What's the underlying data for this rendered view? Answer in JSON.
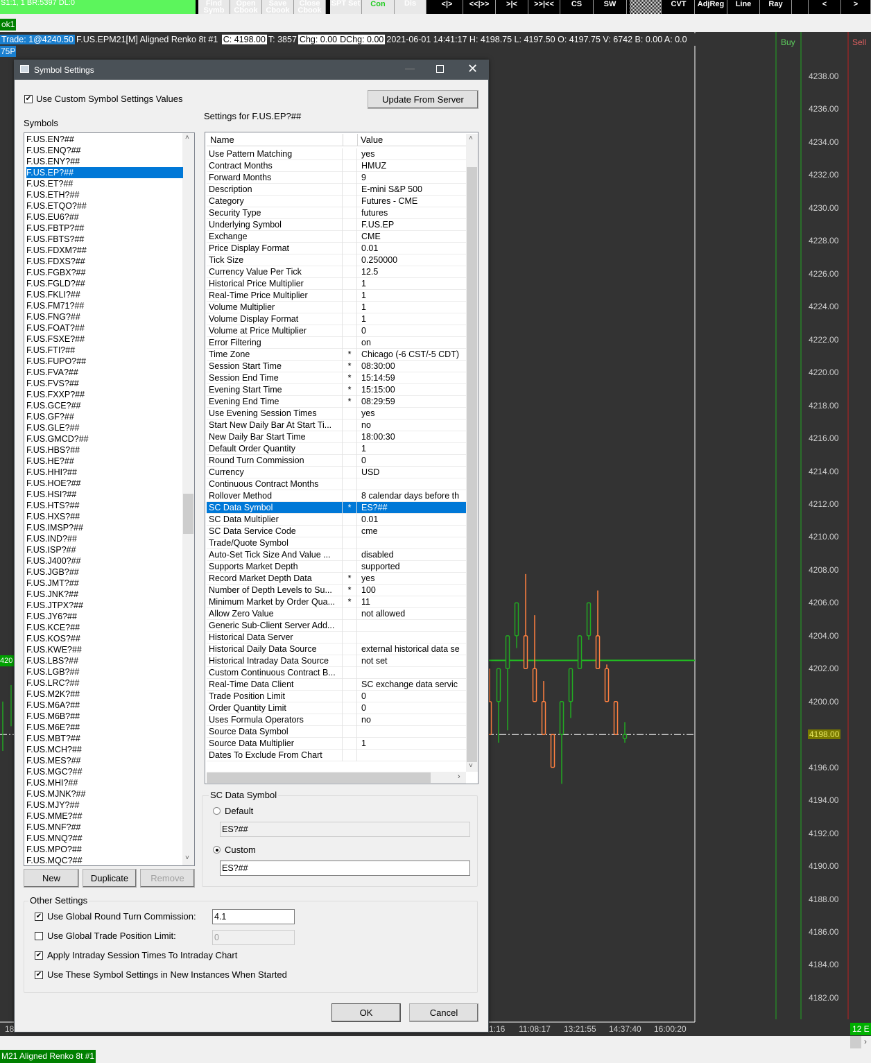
{
  "topbar": {
    "status": "S1:1, 1  BR:5397  DL:0",
    "left_buttons": [
      "Find Symb",
      "Open Cbook",
      "Save Cbook",
      "Close Cbook",
      "SPT Set",
      "Con",
      "Dis"
    ],
    "tool_buttons": [
      "<|>",
      "<<|>>",
      ">|<",
      ">>|<<",
      "CS",
      "SW",
      "",
      "CVT",
      "AdjReg",
      "Line",
      "Ray",
      "",
      "<",
      ">"
    ],
    "con_color": "#22cc22"
  },
  "tabs": {
    "top_tab": "ok1",
    "bottom_tab": "M21  Aligned Renko 8t  #1"
  },
  "chart_info": {
    "trade": "Trade: 1@4240.50",
    "symbol": "F.US.EPM21[M]  Aligned Renko 8t  #1",
    "close": "C: 4198.00",
    "ticks": "T: 3857",
    "chg": "Chg: 0.00",
    "dchg": "DChg: 0.00",
    "rest": "2021-06-01 14:41:17 H: 4198.75 L: 4197.50 O: 4197.75 V: 6742 B: 0.00 A: 0.0",
    "second_line": "75P",
    "buy_label": "Buy",
    "sell_label": "Sell",
    "left_price_tag": "420",
    "left_time_fragment": "18",
    "right_tag": "12 E"
  },
  "chart_data": {
    "type": "candlestick",
    "y_ticks": [
      "4238.00",
      "4236.00",
      "4234.00",
      "4232.00",
      "4230.00",
      "4228.00",
      "4226.00",
      "4224.00",
      "4222.00",
      "4220.00",
      "4218.00",
      "4216.00",
      "4214.00",
      "4212.00",
      "4210.00",
      "4208.00",
      "4206.00",
      "4204.00",
      "4202.00",
      "4200.00",
      "4198.00",
      "4196.00",
      "4194.00",
      "4192.00",
      "4190.00",
      "4188.00",
      "4186.00",
      "4184.00",
      "4182.00"
    ],
    "ylim": [
      4182,
      4238
    ],
    "current_price_label": "4198.00",
    "current_price": 4198,
    "green_level": 4202.5,
    "x_ticks": [
      "1:16",
      "11:08:17",
      "13:21:55",
      "14:37:40",
      "16:00:20"
    ],
    "up_color": "#22a822",
    "down_color": "#ff8040",
    "candles": [
      {
        "o": 4200,
        "h": 4202,
        "l": 4198,
        "c": 4198
      },
      {
        "o": 4200,
        "h": 4202,
        "l": 4197.5,
        "c": 4202
      },
      {
        "o": 4202,
        "h": 4204,
        "l": 4198.25,
        "c": 4204
      },
      {
        "o": 4204,
        "h": 4206,
        "l": 4203.25,
        "c": 4206
      },
      {
        "o": 4204,
        "h": 4207.75,
        "l": 4202,
        "c": 4202
      },
      {
        "o": 4202,
        "h": 4205.25,
        "l": 4200,
        "c": 4200
      },
      {
        "o": 4200,
        "h": 4201.25,
        "l": 4198,
        "c": 4198
      },
      {
        "o": 4198,
        "h": 4198,
        "l": 4196,
        "c": 4196
      },
      {
        "o": 4198,
        "h": 4200,
        "l": 4195,
        "c": 4200
      },
      {
        "o": 4200,
        "h": 4202,
        "l": 4199,
        "c": 4202
      },
      {
        "o": 4202,
        "h": 4204,
        "l": 4202,
        "c": 4204
      },
      {
        "o": 4204,
        "h": 4206,
        "l": 4203.75,
        "c": 4206
      },
      {
        "o": 4204,
        "h": 4206.75,
        "l": 4202,
        "c": 4202
      },
      {
        "o": 4202,
        "h": 4202.25,
        "l": 4200,
        "c": 4200
      },
      {
        "o": 4200,
        "h": 4200,
        "l": 4198,
        "c": 4198
      },
      {
        "o": 4197.75,
        "h": 4198.75,
        "l": 4197.5,
        "c": 4198
      }
    ]
  },
  "dialog": {
    "title": "Symbol Settings",
    "use_custom_label": "Use Custom Symbol Settings Values",
    "use_custom_checked": true,
    "update_button": "Update From Server",
    "symbols_label": "Symbols",
    "settings_for": "Settings for F.US.EP?##",
    "symbols": [
      "F.US.EN?##",
      "F.US.ENQ?##",
      "F.US.ENY?##",
      "F.US.EP?##",
      "F.US.ET?##",
      "F.US.ETH?##",
      "F.US.ETQO?##",
      "F.US.EU6?##",
      "F.US.FBTP?##",
      "F.US.FBTS?##",
      "F.US.FDXM?##",
      "F.US.FDXS?##",
      "F.US.FGBX?##",
      "F.US.FGLD?##",
      "F.US.FKLI?##",
      "F.US.FM71?##",
      "F.US.FNG?##",
      "F.US.FOAT?##",
      "F.US.FSXE?##",
      "F.US.FTI?##",
      "F.US.FUPO?##",
      "F.US.FVA?##",
      "F.US.FVS?##",
      "F.US.FXXP?##",
      "F.US.GCE?##",
      "F.US.GF?##",
      "F.US.GLE?##",
      "F.US.GMCD?##",
      "F.US.HBS?##",
      "F.US.HE?##",
      "F.US.HHI?##",
      "F.US.HOE?##",
      "F.US.HSI?##",
      "F.US.HTS?##",
      "F.US.HXS?##",
      "F.US.IMSP?##",
      "F.US.IND?##",
      "F.US.ISP?##",
      "F.US.J400?##",
      "F.US.JGB?##",
      "F.US.JMT?##",
      "F.US.JNK?##",
      "F.US.JTPX?##",
      "F.US.JY6?##",
      "F.US.KCE?##",
      "F.US.KOS?##",
      "F.US.KWE?##",
      "F.US.LBS?##",
      "F.US.LGB?##",
      "F.US.LRC?##",
      "F.US.M2K?##",
      "F.US.M6A?##",
      "F.US.M6B?##",
      "F.US.M6E?##",
      "F.US.MBT?##",
      "F.US.MCH?##",
      "F.US.MES?##",
      "F.US.MGC?##",
      "F.US.MHI?##",
      "F.US.MJNK?##",
      "F.US.MJY?##",
      "F.US.MME?##",
      "F.US.MNF?##",
      "F.US.MNQ?##",
      "F.US.MPO?##",
      "F.US.MQC?##"
    ],
    "selected_symbol": "F.US.EP?##",
    "symbol_buttons": {
      "new": "New",
      "duplicate": "Duplicate",
      "remove": "Remove"
    },
    "grid_headers": {
      "name": "Name",
      "value": "Value"
    },
    "settings": [
      [
        "Use Pattern Matching",
        "",
        "yes"
      ],
      [
        "Contract Months",
        "",
        "HMUZ"
      ],
      [
        "Forward Months",
        "",
        "9"
      ],
      [
        "Description",
        "",
        "E-mini S&P 500"
      ],
      [
        "Category",
        "",
        "Futures - CME"
      ],
      [
        "Security Type",
        "",
        "futures"
      ],
      [
        "Underlying Symbol",
        "",
        "F.US.EP"
      ],
      [
        "Exchange",
        "",
        "CME"
      ],
      [
        "Price Display Format",
        "",
        "0.01"
      ],
      [
        "Tick Size",
        "",
        "0.250000"
      ],
      [
        "Currency Value Per Tick",
        "",
        "12.5"
      ],
      [
        "Historical Price Multiplier",
        "",
        "1"
      ],
      [
        "Real-Time Price Multiplier",
        "",
        "1"
      ],
      [
        "Volume Multiplier",
        "",
        "1"
      ],
      [
        "Volume Display Format",
        "",
        "1"
      ],
      [
        "Volume at Price Multiplier",
        "",
        "0"
      ],
      [
        "Error Filtering",
        "",
        "on"
      ],
      [
        "Time Zone",
        "*",
        "Chicago (-6 CST/-5 CDT)"
      ],
      [
        "Session Start Time",
        "*",
        "08:30:00"
      ],
      [
        "Session End Time",
        "*",
        "15:14:59"
      ],
      [
        "Evening Start Time",
        "*",
        "15:15:00"
      ],
      [
        "Evening End Time",
        "*",
        "08:29:59"
      ],
      [
        "Use Evening Session Times",
        "",
        "yes"
      ],
      [
        "Start New Daily Bar At Start Ti...",
        "",
        "no"
      ],
      [
        "New Daily Bar Start Time",
        "",
        "18:00:30"
      ],
      [
        "Default Order Quantity",
        "",
        "1"
      ],
      [
        "Round Turn Commission",
        "",
        "0"
      ],
      [
        "Currency",
        "",
        "USD"
      ],
      [
        "Continuous Contract Months",
        "",
        ""
      ],
      [
        "Rollover Method",
        "",
        "8 calendar days before th"
      ],
      [
        "SC Data Symbol",
        "*",
        "ES?##"
      ],
      [
        "SC Data Multiplier",
        "",
        "0.01"
      ],
      [
        "SC Data Service Code",
        "",
        "cme"
      ],
      [
        "Trade/Quote Symbol",
        "",
        ""
      ],
      [
        "Auto-Set Tick Size And Value ...",
        "",
        "disabled"
      ],
      [
        "Supports Market Depth",
        "",
        "supported"
      ],
      [
        "Record Market Depth Data",
        "*",
        "yes"
      ],
      [
        "Number of Depth Levels to Su...",
        "*",
        "100"
      ],
      [
        "Minimum Market by Order Qua...",
        "*",
        "11"
      ],
      [
        "Allow Zero Value",
        "",
        "not allowed"
      ],
      [
        "Generic Sub-Client Server Add...",
        "",
        ""
      ],
      [
        "Historical Data Server",
        "",
        ""
      ],
      [
        "Historical Daily Data Source",
        "",
        "external historical data se"
      ],
      [
        "Historical Intraday Data Source",
        "",
        "not set"
      ],
      [
        "Custom Continuous Contract B...",
        "",
        ""
      ],
      [
        "Real-Time Data Client",
        "",
        "SC exchange data servic"
      ],
      [
        "Trade Position Limit",
        "",
        "0"
      ],
      [
        "Order Quantity Limit",
        "",
        "0"
      ],
      [
        "Uses Formula Operators",
        "",
        "no"
      ],
      [
        "Source Data Symbol",
        "",
        ""
      ],
      [
        "Source Data Multiplier",
        "",
        "1"
      ],
      [
        "Dates To Exclude From Chart",
        "",
        ""
      ]
    ],
    "selected_setting": "SC Data Symbol",
    "sc_data_symbol": {
      "title": "SC Data Symbol",
      "default_label": "Default",
      "default_value": "ES?##",
      "custom_label": "Custom",
      "custom_value": "ES?##",
      "selected": "Custom"
    },
    "other_settings": {
      "title": "Other Settings",
      "global_commission_label": "Use Global Round Turn Commission:",
      "global_commission_checked": true,
      "global_commission_value": "4.1",
      "global_position_label": "Use Global Trade Position Limit:",
      "global_position_checked": false,
      "global_position_value": "0",
      "apply_session_label": "Apply Intraday Session Times To Intraday Chart",
      "apply_session_checked": true,
      "use_new_instances_label": "Use These Symbol Settings in New Instances When Started",
      "use_new_instances_checked": true
    },
    "ok": "OK",
    "cancel": "Cancel"
  }
}
